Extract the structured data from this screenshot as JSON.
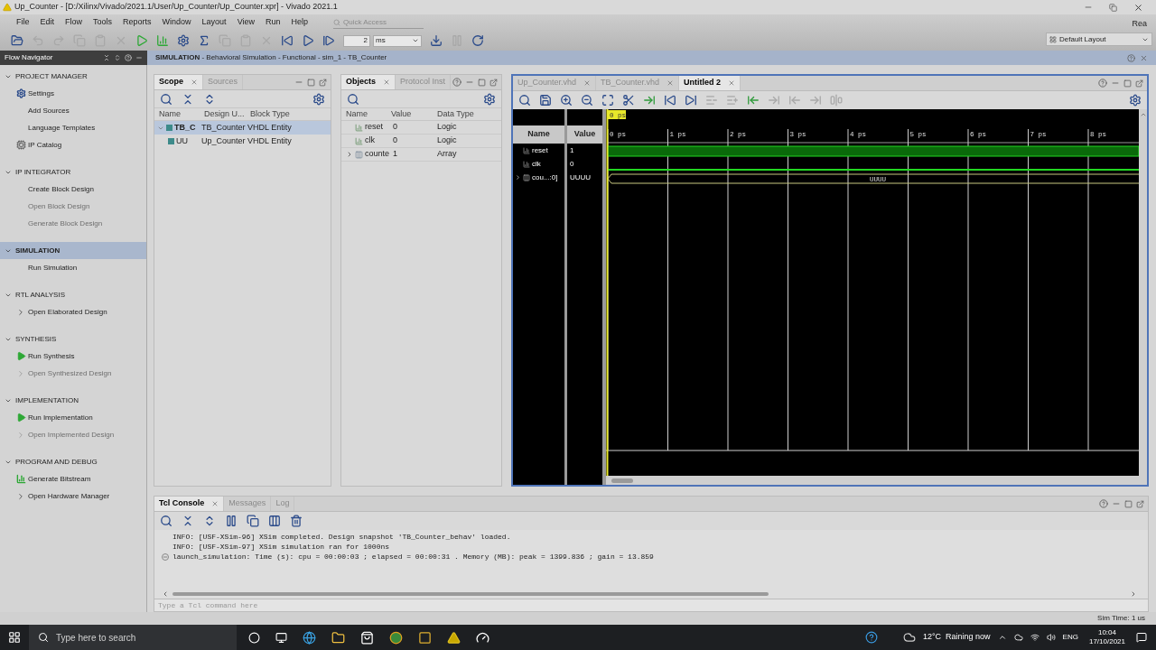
{
  "window": {
    "title": "Up_Counter - [D:/Xilinx/Vivado/2021.1/User/Up_Counter/Up_Counter.xpr] - Vivado 2021.1"
  },
  "menu": [
    "File",
    "Edit",
    "Flow",
    "Tools",
    "Reports",
    "Window",
    "Layout",
    "View",
    "Run",
    "Help"
  ],
  "quick_access": {
    "placeholder": "Quick Access"
  },
  "status_text": "Rea",
  "layout_select": {
    "value": "Default Layout"
  },
  "main_toolbar": {
    "buttons": [
      {
        "disabled": false
      },
      {
        "disabled": true
      },
      {
        "disabled": true
      },
      {
        "disabled": true
      },
      {
        "disabled": true
      },
      {
        "disabled": true
      },
      {
        "disabled": false
      },
      {
        "disabled": false
      },
      {
        "disabled": false
      },
      {
        "disabled": false
      },
      {
        "disabled": true
      },
      {
        "disabled": true
      },
      {
        "disabled": true
      },
      {
        "disabled": false
      },
      {
        "disabled": false
      },
      {
        "disabled": false
      }
    ],
    "run_time": "2",
    "run_unit": "ms",
    "after": [
      {
        "disabled": false
      },
      {
        "disabled": true
      },
      {
        "disabled": false
      }
    ]
  },
  "flow_navigator": {
    "title": "Flow Navigator",
    "sections": [
      {
        "title": "PROJECT MANAGER",
        "expanded": true,
        "selected": false,
        "items": [
          {
            "label": "Settings",
            "kind": "settings",
            "disabled": false
          },
          {
            "label": "Add Sources",
            "kind": "plain",
            "disabled": false
          },
          {
            "label": "Language Templates",
            "kind": "plain",
            "disabled": false
          },
          {
            "label": "IP Catalog",
            "kind": "catalog",
            "disabled": false
          }
        ]
      },
      {
        "title": "IP INTEGRATOR",
        "expanded": true,
        "selected": false,
        "items": [
          {
            "label": "Create Block Design",
            "kind": "plain",
            "disabled": false
          },
          {
            "label": "Open Block Design",
            "kind": "plain",
            "disabled": true
          },
          {
            "label": "Generate Block Design",
            "kind": "plain",
            "disabled": true
          }
        ]
      },
      {
        "title": "SIMULATION",
        "expanded": true,
        "selected": true,
        "items": [
          {
            "label": "Run Simulation",
            "kind": "plain",
            "disabled": false
          }
        ]
      },
      {
        "title": "RTL ANALYSIS",
        "expanded": true,
        "selected": false,
        "items": [
          {
            "label": "Open Elaborated Design",
            "kind": "expand",
            "disabled": false
          }
        ]
      },
      {
        "title": "SYNTHESIS",
        "expanded": true,
        "selected": false,
        "items": [
          {
            "label": "Run Synthesis",
            "kind": "run",
            "disabled": false
          },
          {
            "label": "Open Synthesized Design",
            "kind": "expand",
            "disabled": true
          }
        ]
      },
      {
        "title": "IMPLEMENTATION",
        "expanded": true,
        "selected": false,
        "items": [
          {
            "label": "Run Implementation",
            "kind": "run",
            "disabled": false
          },
          {
            "label": "Open Implemented Design",
            "kind": "expand",
            "disabled": true
          }
        ]
      },
      {
        "title": "PROGRAM AND DEBUG",
        "expanded": true,
        "selected": false,
        "items": [
          {
            "label": "Generate Bitstream",
            "kind": "bitstream",
            "disabled": false
          },
          {
            "label": "Open Hardware Manager",
            "kind": "expand",
            "disabled": false
          }
        ]
      }
    ]
  },
  "sim_header": {
    "title": "SIMULATION",
    "subtitle": " - Behavioral Simulation - Functional - sim_1 - TB_Counter"
  },
  "scope": {
    "tabs": [
      {
        "label": "Scope",
        "selected": true
      },
      {
        "label": "Sources",
        "selected": false
      }
    ],
    "columns": [
      "Name",
      "Design U...",
      "Block Type"
    ],
    "rows": [
      {
        "cells": [
          "TB_C",
          "TB_Counter",
          "VHDL Entity"
        ],
        "selected": true,
        "expanded": true,
        "children": [
          {
            "cells": [
              "UU",
              "Up_Counter",
              "VHDL Entity"
            ],
            "selected": false
          }
        ]
      }
    ]
  },
  "objects": {
    "tabs": [
      {
        "label": "Objects",
        "selected": true
      },
      {
        "label": "Protocol Inst",
        "selected": false
      }
    ],
    "columns": [
      "Name",
      "Value",
      "Data Type"
    ],
    "rows": [
      {
        "name": "reset",
        "value": "0",
        "type": "Logic",
        "kind": "logic"
      },
      {
        "name": "clk",
        "value": "0",
        "type": "Logic",
        "kind": "logic"
      },
      {
        "name": "counte",
        "value": "1",
        "type": "Array",
        "kind": "array",
        "expanded": false
      }
    ]
  },
  "wave": {
    "tabs": [
      {
        "label": "Up_Counter.vhd",
        "selected": false
      },
      {
        "label": "TB_Counter.vhd",
        "selected": false
      },
      {
        "label": "Untitled 2",
        "selected": true
      }
    ],
    "toolbar": [
      {
        "disabled": false
      },
      {
        "disabled": false
      },
      {
        "disabled": false
      },
      {
        "disabled": false
      },
      {
        "disabled": false
      },
      {
        "disabled": false
      },
      {
        "disabled": false
      },
      {
        "disabled": false
      },
      {
        "disabled": false
      },
      {
        "disabled": true
      },
      {
        "disabled": true
      },
      {
        "disabled": false
      },
      {
        "disabled": true
      },
      {
        "disabled": true
      },
      {
        "disabled": true
      },
      {
        "disabled": true
      }
    ],
    "cursor": "0 ps",
    "columns": [
      "Name",
      "Value"
    ],
    "ticks": [
      "0 ps",
      "1 ps",
      "2 ps",
      "3 ps",
      "4 ps",
      "5 ps",
      "6 ps",
      "7 ps",
      "8 ps"
    ],
    "signals": [
      {
        "name": "reset",
        "value": "1",
        "kind": "bit",
        "high": true
      },
      {
        "name": "clk",
        "value": "0",
        "kind": "bit",
        "high": false
      },
      {
        "name": "cou...:0]",
        "value": "UUUU",
        "kind": "bus",
        "expanded": false,
        "bus_label": "UUUU"
      }
    ]
  },
  "console": {
    "tabs": [
      {
        "label": "Tcl Console",
        "selected": true
      },
      {
        "label": "Messages",
        "selected": false
      },
      {
        "label": "Log",
        "selected": false
      }
    ],
    "lines": [
      {
        "text": "INFO: [USF-XSim-96] XSim completed. Design snapshot 'TB_Counter_behav' loaded.",
        "kind": "info"
      },
      {
        "text": "INFO: [USF-XSim-97] XSim simulation ran for 1000ns",
        "kind": "info"
      },
      {
        "text": "launch_simulation: Time (s): cpu = 00:00:03 ; elapsed = 00:00:31 . Memory (MB): peak = 1399.836 ; gain = 13.859",
        "kind": "command"
      }
    ],
    "placeholder": "Type a Tcl command here"
  },
  "status_bar": {
    "sim_time": "Sim Time: 1 us"
  },
  "taskbar": {
    "search_placeholder": "Type here to search",
    "weather": "12°C  Raining now",
    "language": "ENG",
    "time": "10:04",
    "date": "17/10/2021"
  }
}
